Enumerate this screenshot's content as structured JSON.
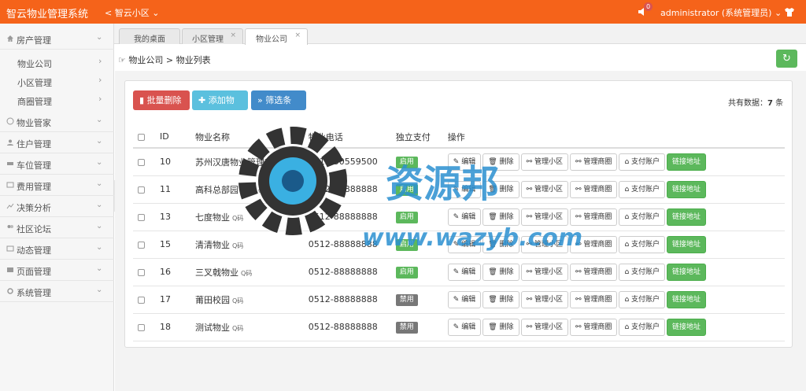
{
  "header": {
    "app_title": "智云物业管理系统",
    "community_label": "智云小区",
    "notification_count": "0",
    "user_label": "administrator (系统管理员)"
  },
  "sidebar": {
    "items": [
      {
        "label": "房产管理"
      },
      {
        "label": "物业管家"
      },
      {
        "label": "住户管理"
      },
      {
        "label": "车位管理"
      },
      {
        "label": "费用管理"
      },
      {
        "label": "决策分析"
      },
      {
        "label": "社区论坛"
      },
      {
        "label": "动态管理"
      },
      {
        "label": "页面管理"
      },
      {
        "label": "系统管理"
      }
    ],
    "subitems": [
      {
        "label": "物业公司"
      },
      {
        "label": "小区管理"
      },
      {
        "label": "商圈管理"
      }
    ]
  },
  "tabs": [
    {
      "label": "我的桌面"
    },
    {
      "label": "小区管理"
    },
    {
      "label": "物业公司"
    }
  ],
  "breadcrumb": "物业公司 > 物业列表",
  "toolbar": {
    "batch_delete": "批量删除",
    "add": "添加物业",
    "filter": "筛选条件",
    "total_label": "共有数据：",
    "total_count": "7",
    "total_unit": " 条"
  },
  "table": {
    "headers": [
      "ID",
      "物业名称",
      "物业电话",
      "独立支付",
      "操作"
    ],
    "actions": [
      "编辑",
      "删除",
      "管理小区",
      "管理商圈",
      "支付账户",
      "链接地址"
    ],
    "qr_label": "Q码",
    "rows": [
      {
        "id": "10",
        "name": "苏州汉唐物业管理有限...",
        "phone": "0512-50559500",
        "pay": "启用",
        "enabled": true
      },
      {
        "id": "11",
        "name": "高科总部园管理",
        "phone": "0512-88888888",
        "pay": "启用",
        "enabled": true
      },
      {
        "id": "13",
        "name": "七度物业",
        "phone": "0512-88888888",
        "pay": "启用",
        "enabled": true
      },
      {
        "id": "15",
        "name": "清清物业",
        "phone": "0512-88888888",
        "pay": "启用",
        "enabled": true
      },
      {
        "id": "16",
        "name": "三叉戟物业",
        "phone": "0512-88888888",
        "pay": "启用",
        "enabled": true
      },
      {
        "id": "17",
        "name": "莆田校园",
        "phone": "0512-88888888",
        "pay": "禁用",
        "enabled": false
      },
      {
        "id": "18",
        "name": "测试物业",
        "phone": "0512-88888888",
        "pay": "禁用",
        "enabled": false
      }
    ]
  },
  "watermark": {
    "title": "资源邦",
    "url": "www.wazyb.com"
  },
  "colors": {
    "brand": "#f5631a",
    "success": "#5cb85c",
    "danger": "#d9534f",
    "info": "#5bc0de",
    "primary": "#428bca"
  }
}
